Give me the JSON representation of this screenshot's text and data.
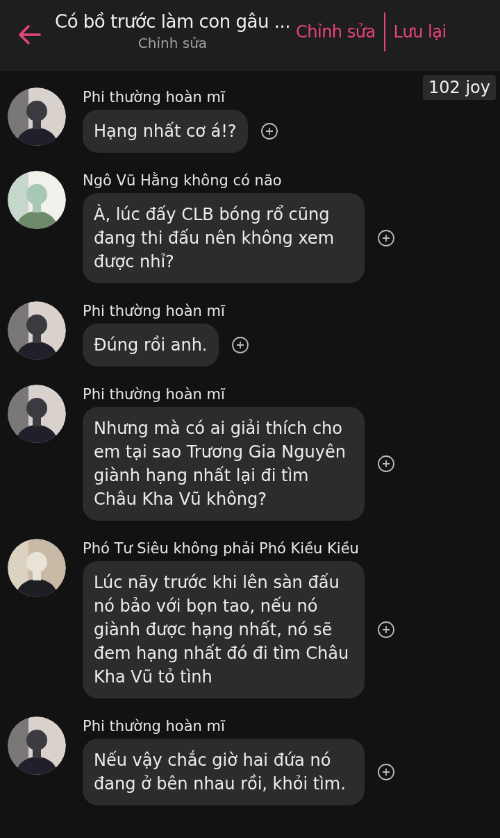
{
  "header": {
    "title": "Có bồ trước làm con gâu ...",
    "subtitle": "Chỉnh sửa",
    "actions": [
      "Chỉnh sửa",
      "Lưu lại"
    ]
  },
  "badge": "102 joy",
  "messages": [
    {
      "author": "Phi thường hoàn mĩ",
      "text": "Hạng nhất cơ á!?"
    },
    {
      "author": "Ngô Vũ Hằng không có não",
      "text": "À, lúc đấy CLB bóng rổ cũng đang thi đấu nên không xem được nhỉ?"
    },
    {
      "author": "Phi thường hoàn mĩ",
      "text": "Đúng rồi anh."
    },
    {
      "author": "Phi thường hoàn mĩ",
      "text": "Nhưng mà có ai giải thích cho em tại sao Trương Gia Nguyên giành hạng nhất lại đi tìm Châu Kha Vũ không?"
    },
    {
      "author": "Phó Tư Siêu không phải Phó Kiều Kiều",
      "text": "Lúc nãy trước khi lên sàn đấu nó bảo với bọn tao, nếu nó giành được hạng nhất, nó sẽ đem hạng nhất đó đi tìm Châu Kha Vũ tỏ tình"
    },
    {
      "author": "Phi thường hoàn mĩ",
      "text": "Nếu vậy chắc giờ hai đứa nó đang ở bên nhau rồi, khỏi tìm."
    }
  ]
}
